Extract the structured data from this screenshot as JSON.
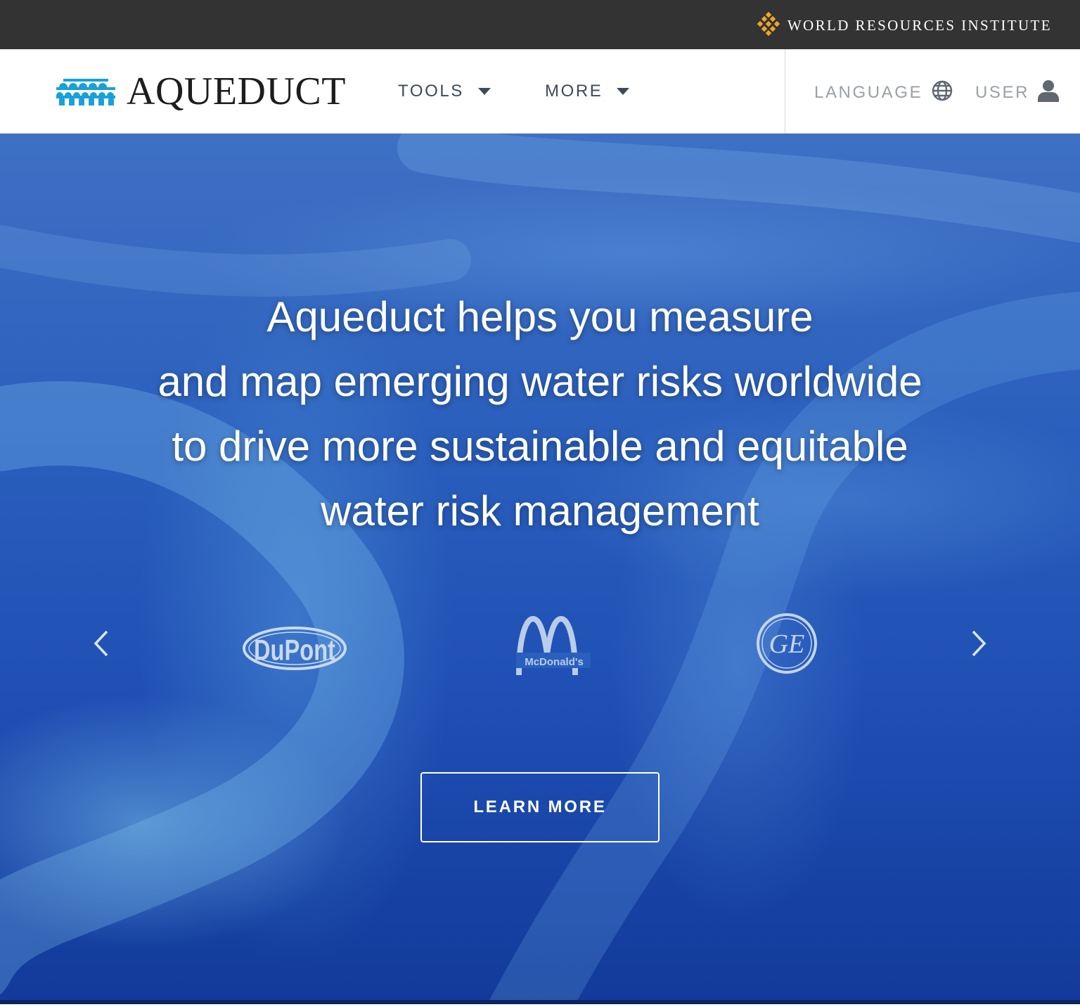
{
  "topbar": {
    "org_name": "WORLD RESOURCES INSTITUTE",
    "org_icon": "wri-logo-icon",
    "org_icon_color": "#f0a52a"
  },
  "header": {
    "brand_name": "AQUEDUCT",
    "brand_icon": "aqueduct-arches-icon",
    "brand_icon_color": "#1aa0d8",
    "nav": {
      "tools_label": "TOOLS",
      "more_label": "MORE"
    },
    "utility": {
      "language_label": "LANGUAGE",
      "user_label": "USER"
    }
  },
  "hero": {
    "headline_lines": [
      "Aqueduct helps you measure",
      "and map emerging water risks worldwide",
      "to drive more sustainable and equitable",
      "water risk management"
    ],
    "partner_logos": [
      "DuPont",
      "McDonald's",
      "GE"
    ],
    "cta_label": "LEARN MORE",
    "background_color": "#2a5fbd"
  }
}
